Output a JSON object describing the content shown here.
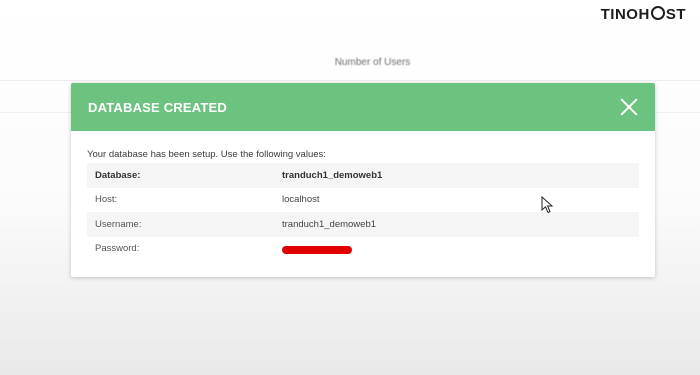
{
  "brand": {
    "logo_text_1": "TINO",
    "logo_text_2": "HST"
  },
  "background": {
    "column_title": "Number of Users"
  },
  "modal": {
    "title": "DATABASE CREATED",
    "intro": "Your database has been setup. Use the following values:",
    "rows": [
      {
        "label": "Database:",
        "value": "tranduch1_demoweb1"
      },
      {
        "label": "Host:",
        "value": "localhost"
      },
      {
        "label": "Username:",
        "value": "tranduch1_demoweb1"
      },
      {
        "label": "Password:",
        "value": ""
      }
    ]
  },
  "colors": {
    "header": "#6cc27f",
    "redaction": "#e00000"
  },
  "icons": {
    "close": "close-icon",
    "cursor": "mouse-pointer-icon"
  }
}
